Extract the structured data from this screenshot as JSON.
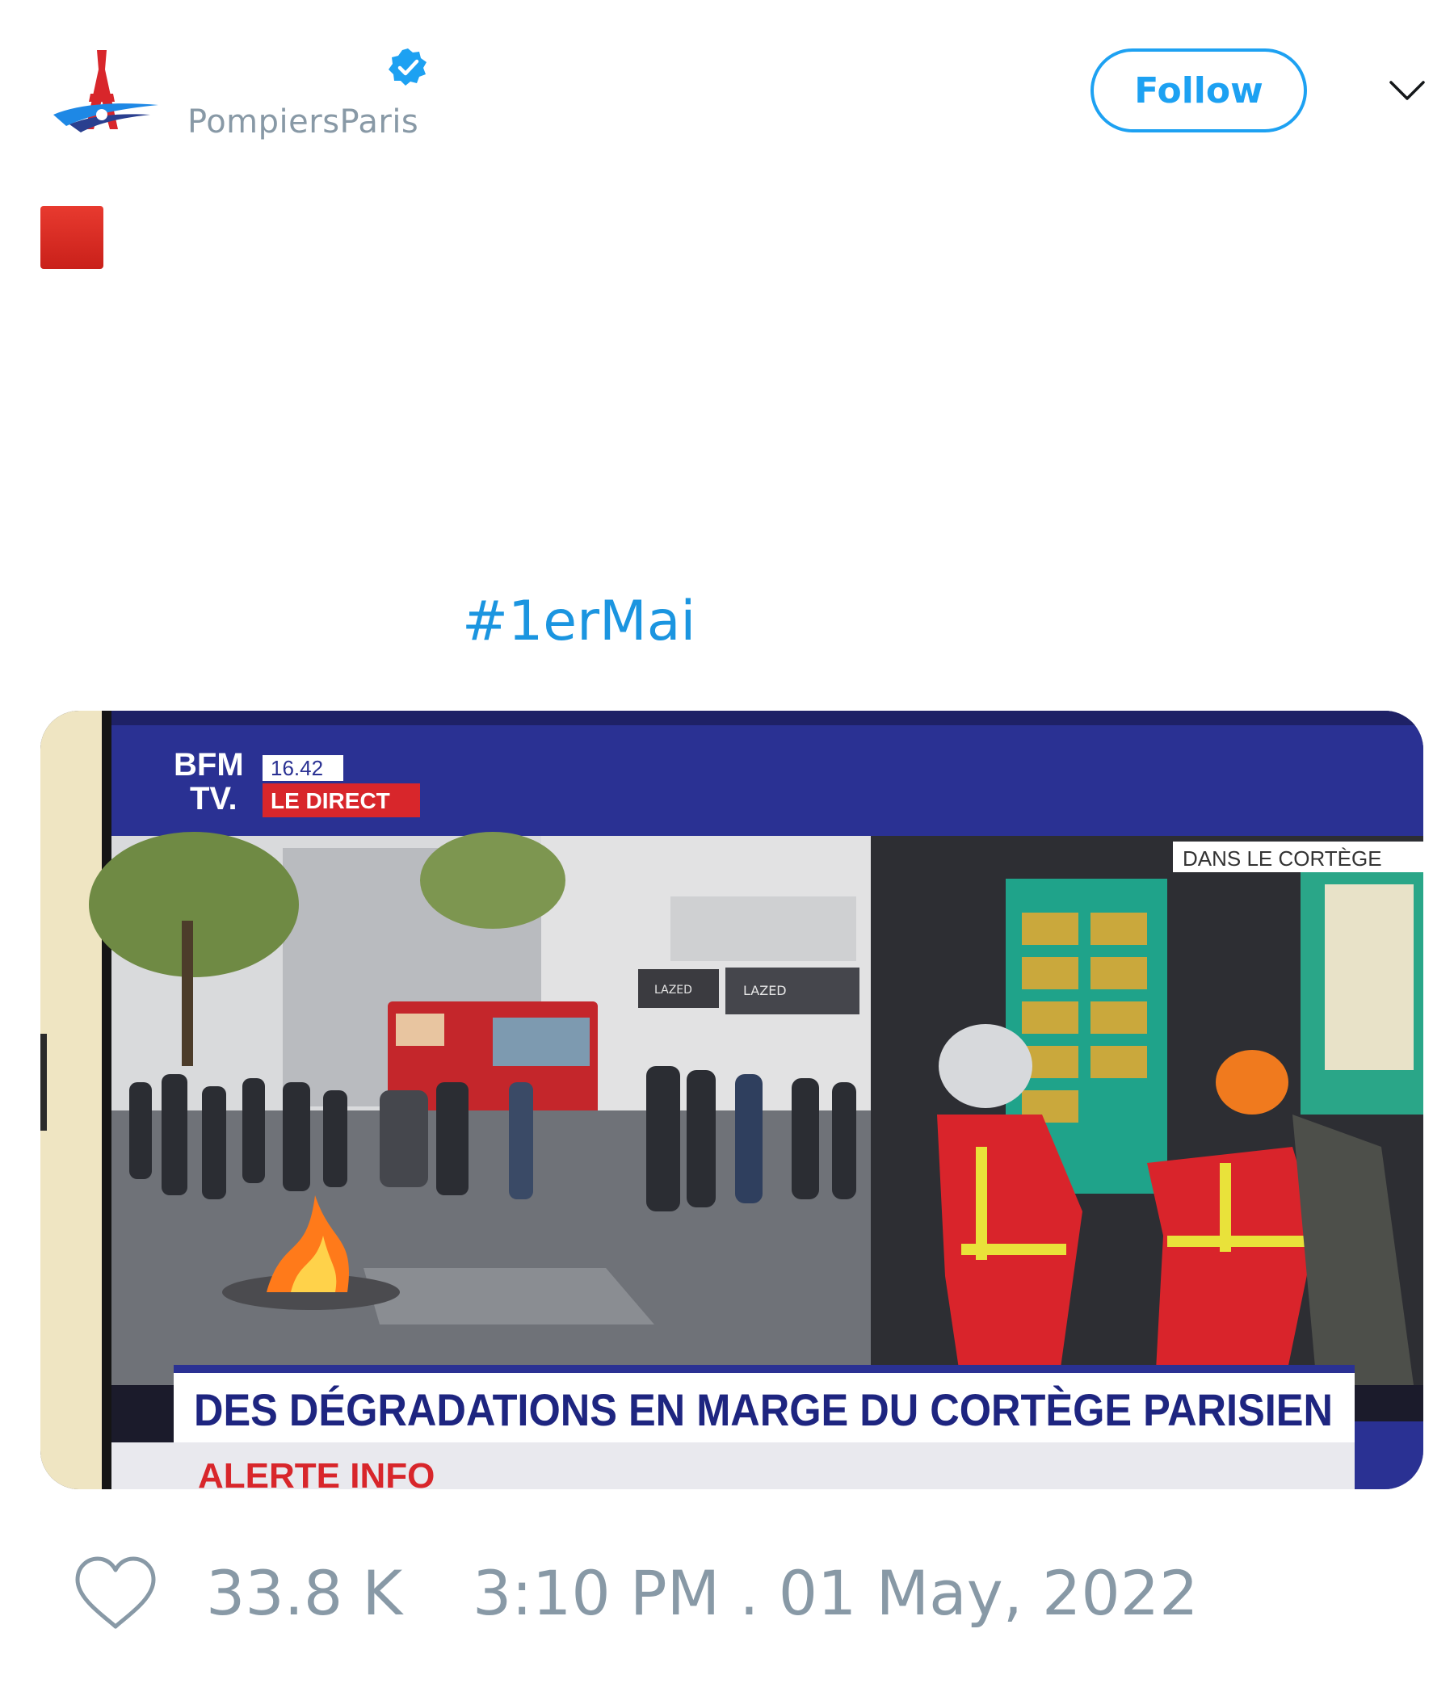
{
  "account": {
    "handle": "PompiersParis",
    "avatar": "eiffel-tower-emblem-icon",
    "verified_icon": "verified-badge-icon",
    "accent_color": "#1da1f2"
  },
  "header": {
    "follow_label": "Follow",
    "menu_icon": "chevron-down-icon"
  },
  "body": {
    "emoji": "red-square-icon",
    "hashtag": "#1erMai"
  },
  "media": {
    "channel_logo_line1": "BFM",
    "channel_logo_line2": "TV.",
    "clock": "16.42",
    "live_label": "LE DIRECT",
    "corner_label": "DANS LE CORTÈGE",
    "shop_sign_1": "LAZED",
    "shop_sign_2": "LAZED",
    "headline": "DES DÉGRADATIONS EN MARGE DU CORTÈGE PARISIEN",
    "ticker_label": "ALERTE INFO"
  },
  "footer": {
    "likes": "33.8 K",
    "timestamp": "3:10 PM . 01 May, 2022"
  }
}
